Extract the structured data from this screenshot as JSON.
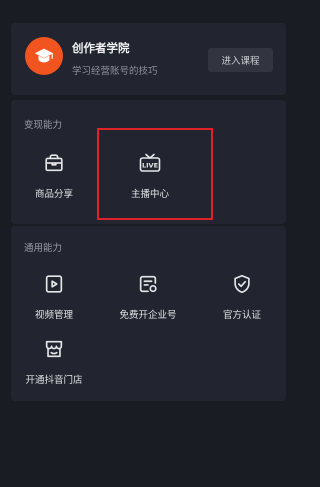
{
  "academy": {
    "title": "创作者学院",
    "subtitle": "学习经营账号的技巧",
    "enter_label": "进入课程",
    "logo_icon": "graduation-cap-icon"
  },
  "monetize": {
    "title": "变现能力",
    "items": [
      {
        "label": "商品分享",
        "icon": "shop-bag-icon"
      },
      {
        "label": "主播中心",
        "icon": "live-tv-icon"
      }
    ]
  },
  "general": {
    "title": "通用能力",
    "items": [
      {
        "label": "视频管理",
        "icon": "video-play-icon"
      },
      {
        "label": "免费开企业号",
        "icon": "enterprise-card-icon"
      },
      {
        "label": "官方认证",
        "icon": "verified-shield-icon"
      },
      {
        "label": "开通抖音门店",
        "icon": "store-icon"
      }
    ]
  },
  "colors": {
    "background": "#1a1c24",
    "card": "#22252f",
    "accent_orange": "#f2541f",
    "highlight_red": "#e02227"
  }
}
